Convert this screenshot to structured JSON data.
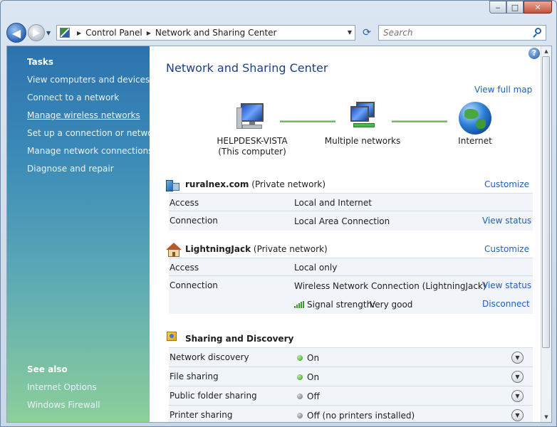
{
  "window": {
    "minimize_glyph": "‒",
    "maximize_glyph": "□",
    "close_glyph": "✕"
  },
  "navigation": {
    "breadcrumbs": [
      "Control Panel",
      "Network and Sharing Center"
    ],
    "search_placeholder": "Search"
  },
  "left_pane": {
    "tasks_heading": "Tasks",
    "tasks": [
      "View computers and devices",
      "Connect to a network",
      "Manage wireless networks",
      "Set up a connection or network",
      "Manage network connections",
      "Diagnose and repair"
    ],
    "see_also_heading": "See also",
    "see_also": [
      "Internet Options",
      "Windows Firewall"
    ]
  },
  "main": {
    "title": "Network and Sharing Center",
    "view_full_map": "View full map",
    "help_glyph": "?",
    "map": {
      "computer_name": "HELPDESK-VISTA",
      "computer_sub": "(This computer)",
      "network_label": "Multiple networks",
      "internet_label": "Internet"
    },
    "networks": [
      {
        "name": "ruralnex.com",
        "type": "(Private network)",
        "customize": "Customize",
        "access_label": "Access",
        "access_value": "Local and Internet",
        "connection_label": "Connection",
        "connection_value": "Local Area Connection",
        "view_status": "View status"
      },
      {
        "name": "LightningJack",
        "type": "(Private network)",
        "customize": "Customize",
        "access_label": "Access",
        "access_value": "Local only",
        "connection_label": "Connection",
        "connection_value": "Wireless Network Connection (LightningJack)",
        "view_status": "View status",
        "signal_label": "Signal strength:",
        "signal_value": "Very good",
        "disconnect": "Disconnect"
      }
    ],
    "sharing": {
      "title": "Sharing and Discovery",
      "items": [
        {
          "label": "Network discovery",
          "status": "On",
          "state": "on"
        },
        {
          "label": "File sharing",
          "status": "On",
          "state": "on"
        },
        {
          "label": "Public folder sharing",
          "status": "Off",
          "state": "off"
        },
        {
          "label": "Printer sharing",
          "status": "Off (no printers installed)",
          "state": "off"
        }
      ]
    }
  }
}
